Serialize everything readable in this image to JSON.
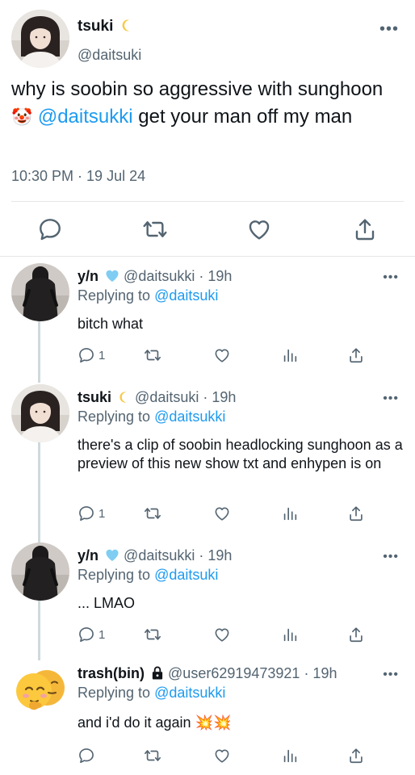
{
  "main_tweet": {
    "name": "tsuki",
    "handle": "@daitsuki",
    "text_part1": "why is soobin so aggressive with sunghoon ",
    "emoji": "🤡",
    "mention": "@daitsukki",
    "text_part2": " get your man off my man",
    "timestamp": "10:30 PM · 19 Jul 24"
  },
  "replies": [
    {
      "name": "y/n",
      "name_badge": "light-blue-heart",
      "meta": "@daitsukki · 19h",
      "replying_prefix": "Replying to ",
      "replying_handle": "@daitsuki",
      "text": "bitch what",
      "reply_count": "1"
    },
    {
      "name": "tsuki",
      "name_badge": "crescent-moon",
      "meta": "@daitsuki · 19h",
      "replying_prefix": "Replying to ",
      "replying_handle": "@daitsukki",
      "text": "there's a clip of soobin headlocking sunghoon as a preview of this new show txt and enhypen is on",
      "reply_count": "1"
    },
    {
      "name": "y/n",
      "name_badge": "light-blue-heart",
      "meta": "@daitsukki · 19h",
      "replying_prefix": "Replying to ",
      "replying_handle": "@daitsuki",
      "text": "... LMAO",
      "reply_count": "1"
    },
    {
      "name": "trash(bin)",
      "name_badge": "lock",
      "meta": "@user62919473921 · 19h",
      "replying_prefix": "Replying to ",
      "replying_handle": "@daitsukki",
      "text": "and i'd do it again 💥💥",
      "reply_count": ""
    }
  ],
  "colors": {
    "accent": "#1d9bf0",
    "secondary_text": "#536471",
    "divider": "#e7e7e7",
    "thread_line": "#cfd9de"
  }
}
